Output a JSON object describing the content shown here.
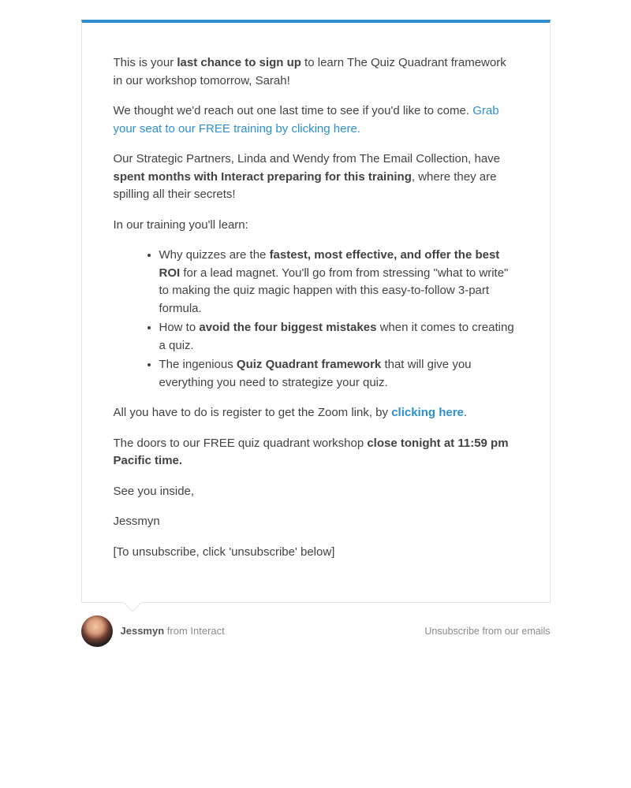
{
  "body": {
    "p1_prefix": "This is your ",
    "p1_bold": "last chance to sign up",
    "p1_suffix": " to learn The Quiz Quadrant framework in our workshop tomorrow, Sarah!",
    "p2_text": "We thought we'd reach out one last time to see if you'd like to come. ",
    "p2_link": "Grab your seat to our FREE training by clicking here.",
    "p3_prefix": "Our Strategic Partners, Linda and Wendy from The Email Collection, have ",
    "p3_bold": "spent months with Interact preparing for this training",
    "p3_suffix": ", where they are spilling all their secrets!",
    "p4": "In our training you'll learn:",
    "bullets": [
      {
        "prefix": "Why quizzes are the ",
        "bold": "fastest, most effective, and offer the best ROI",
        "suffix": " for a lead magnet. You'll go from from stressing \"what to write\" to making the quiz magic happen with this easy-to-follow 3-part formula."
      },
      {
        "prefix": " How to ",
        "bold": "avoid the four biggest mistakes",
        "suffix": " when it comes to creating a quiz."
      },
      {
        "prefix": "The ingenious ",
        "bold": "Quiz Quadrant framework",
        "suffix": " that will give you everything you need to strategize your quiz."
      }
    ],
    "p5_prefix": "All you have to do is register to get the Zoom link, by ",
    "p5_link": "clicking here",
    "p5_suffix": ".",
    "p6_prefix": "The doors to our FREE quiz quadrant workshop ",
    "p6_bold": "close tonight at 11:59 pm Pacific time.",
    "p7": "See you inside,",
    "p8": "Jessmyn",
    "p9": "[To unsubscribe, click 'unsubscribe' below]"
  },
  "footer": {
    "sender_name": "Jessmyn",
    "sender_from": " from Interact",
    "unsubscribe": "Unsubscribe from our emails"
  }
}
